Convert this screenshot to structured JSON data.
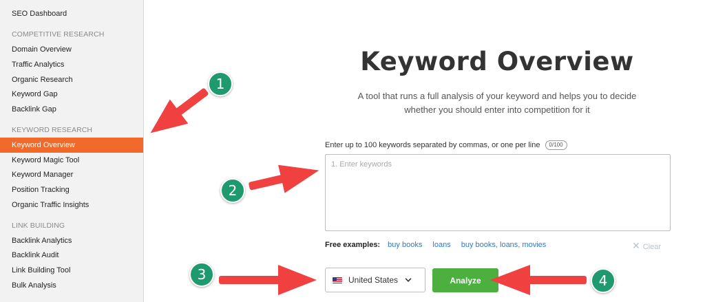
{
  "sidebar": {
    "items": [
      {
        "type": "item",
        "label": "SEO Dashboard",
        "active": false
      },
      {
        "type": "heading",
        "label": "COMPETITIVE RESEARCH"
      },
      {
        "type": "item",
        "label": "Domain Overview",
        "active": false
      },
      {
        "type": "item",
        "label": "Traffic Analytics",
        "active": false
      },
      {
        "type": "item",
        "label": "Organic Research",
        "active": false
      },
      {
        "type": "item",
        "label": "Keyword Gap",
        "active": false
      },
      {
        "type": "item",
        "label": "Backlink Gap",
        "active": false
      },
      {
        "type": "heading",
        "label": "KEYWORD RESEARCH"
      },
      {
        "type": "item",
        "label": "Keyword Overview",
        "active": true
      },
      {
        "type": "item",
        "label": "Keyword Magic Tool",
        "active": false
      },
      {
        "type": "item",
        "label": "Keyword Manager",
        "active": false
      },
      {
        "type": "item",
        "label": "Position Tracking",
        "active": false
      },
      {
        "type": "item",
        "label": "Organic Traffic Insights",
        "active": false
      },
      {
        "type": "heading",
        "label": "LINK BUILDING"
      },
      {
        "type": "item",
        "label": "Backlink Analytics",
        "active": false
      },
      {
        "type": "item",
        "label": "Backlink Audit",
        "active": false
      },
      {
        "type": "item",
        "label": "Link Building Tool",
        "active": false
      },
      {
        "type": "item",
        "label": "Bulk Analysis",
        "active": false
      }
    ],
    "active_color": "#f26a2a"
  },
  "main": {
    "title": "Keyword Overview",
    "subtitle_line1": "A tool that runs a full analysis of your keyword and helps you to decide",
    "subtitle_line2": "whether you should enter into competition for it",
    "instruction": "Enter up to 100 keywords separated by commas, or one per line",
    "counter": "0/100",
    "textarea_placeholder": "1. Enter keywords",
    "examples_label": "Free examples:",
    "examples": [
      "buy books",
      "loans",
      "buy books, loans, movies"
    ],
    "clear_label": "Clear",
    "country": "United States",
    "analyze_label": "Analyze",
    "analyze_color": "#4caf3f"
  },
  "annotations": {
    "badges": [
      "1",
      "2",
      "3",
      "4"
    ],
    "arrow_color": "#f04040",
    "badge_color": "#1e9a6e"
  }
}
